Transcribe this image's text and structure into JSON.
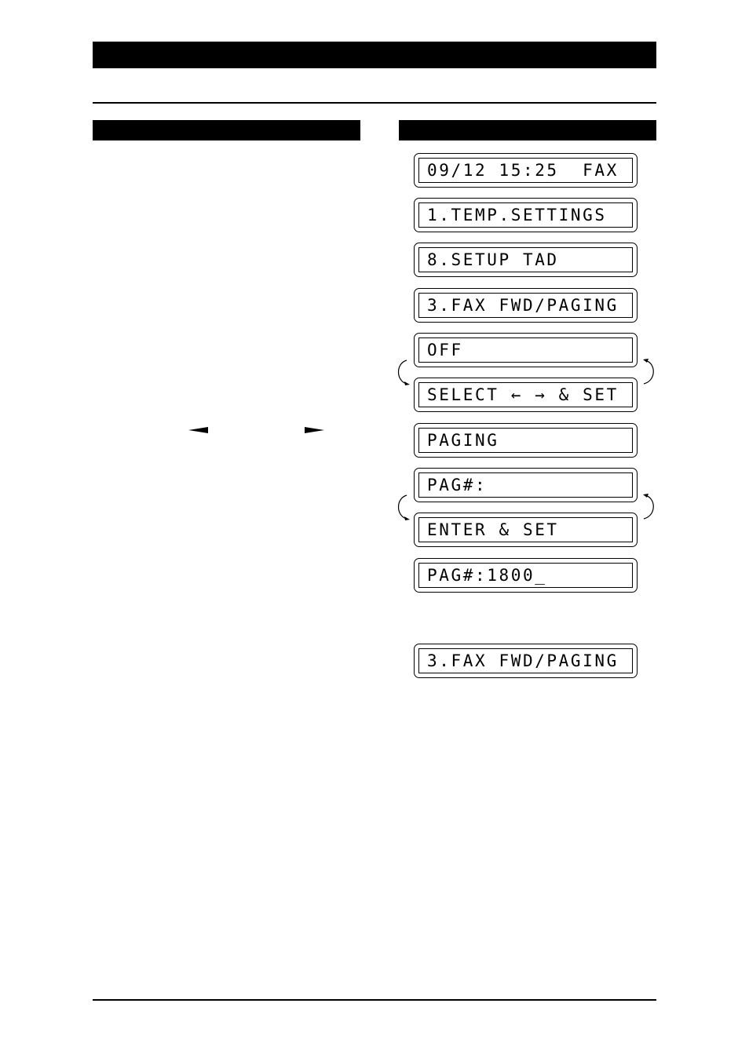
{
  "page": {
    "header_bar_text": "",
    "left_column_heading": "",
    "right_column_heading": ""
  },
  "instructions": {
    "left_arrow_icon": "left-arrow",
    "right_arrow_icon": "right-arrow"
  },
  "lcd_screens": [
    {
      "text": "09/12 15:25  FAX"
    },
    {
      "text": "1.TEMP.SETTINGS"
    },
    {
      "text": "8.SETUP TAD"
    },
    {
      "text": "3.FAX FWD/PAGING"
    },
    {
      "text": "OFF"
    },
    {
      "text": "SELECT ← → & SET"
    },
    {
      "text": "PAGING"
    },
    {
      "text": "PAG#:"
    },
    {
      "text": "ENTER & SET"
    },
    {
      "text": "PAG#:1800_"
    },
    {
      "text": "3.FAX FWD/PAGING"
    }
  ]
}
